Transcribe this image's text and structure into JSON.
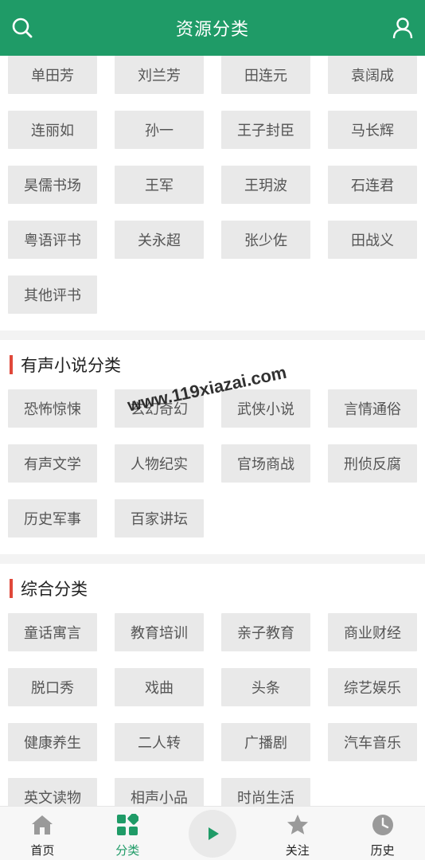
{
  "header": {
    "title": "资源分类"
  },
  "sections": [
    {
      "items": [
        "单田芳",
        "刘兰芳",
        "田连元",
        "袁阔成",
        "连丽如",
        "孙一",
        "王子封臣",
        "马长辉",
        "昊儒书场",
        "王军",
        "王玥波",
        "石连君",
        "粤语评书",
        "关永超",
        "张少佐",
        "田战义",
        "其他评书"
      ]
    },
    {
      "title": "有声小说分类",
      "items": [
        "恐怖惊悚",
        "玄幻奇幻",
        "武侠小说",
        "言情通俗",
        "有声文学",
        "人物纪实",
        "官场商战",
        "刑侦反腐",
        "历史军事",
        "百家讲坛"
      ]
    },
    {
      "title": "综合分类",
      "items": [
        "童话寓言",
        "教育培训",
        "亲子教育",
        "商业财经",
        "脱口秀",
        "戏曲",
        "头条",
        "综艺娱乐",
        "健康养生",
        "二人转",
        "广播剧",
        "汽车音乐",
        "英文读物",
        "相声小品",
        "时尚生活"
      ]
    }
  ],
  "watermark": "www.119xiazai.com",
  "tabbar": {
    "home": "首页",
    "category": "分类",
    "follow": "关注",
    "history": "历史"
  },
  "colors": {
    "brand": "#1f9b67",
    "section_bar": "#e0483a",
    "tag_bg": "#e9e9e9"
  }
}
